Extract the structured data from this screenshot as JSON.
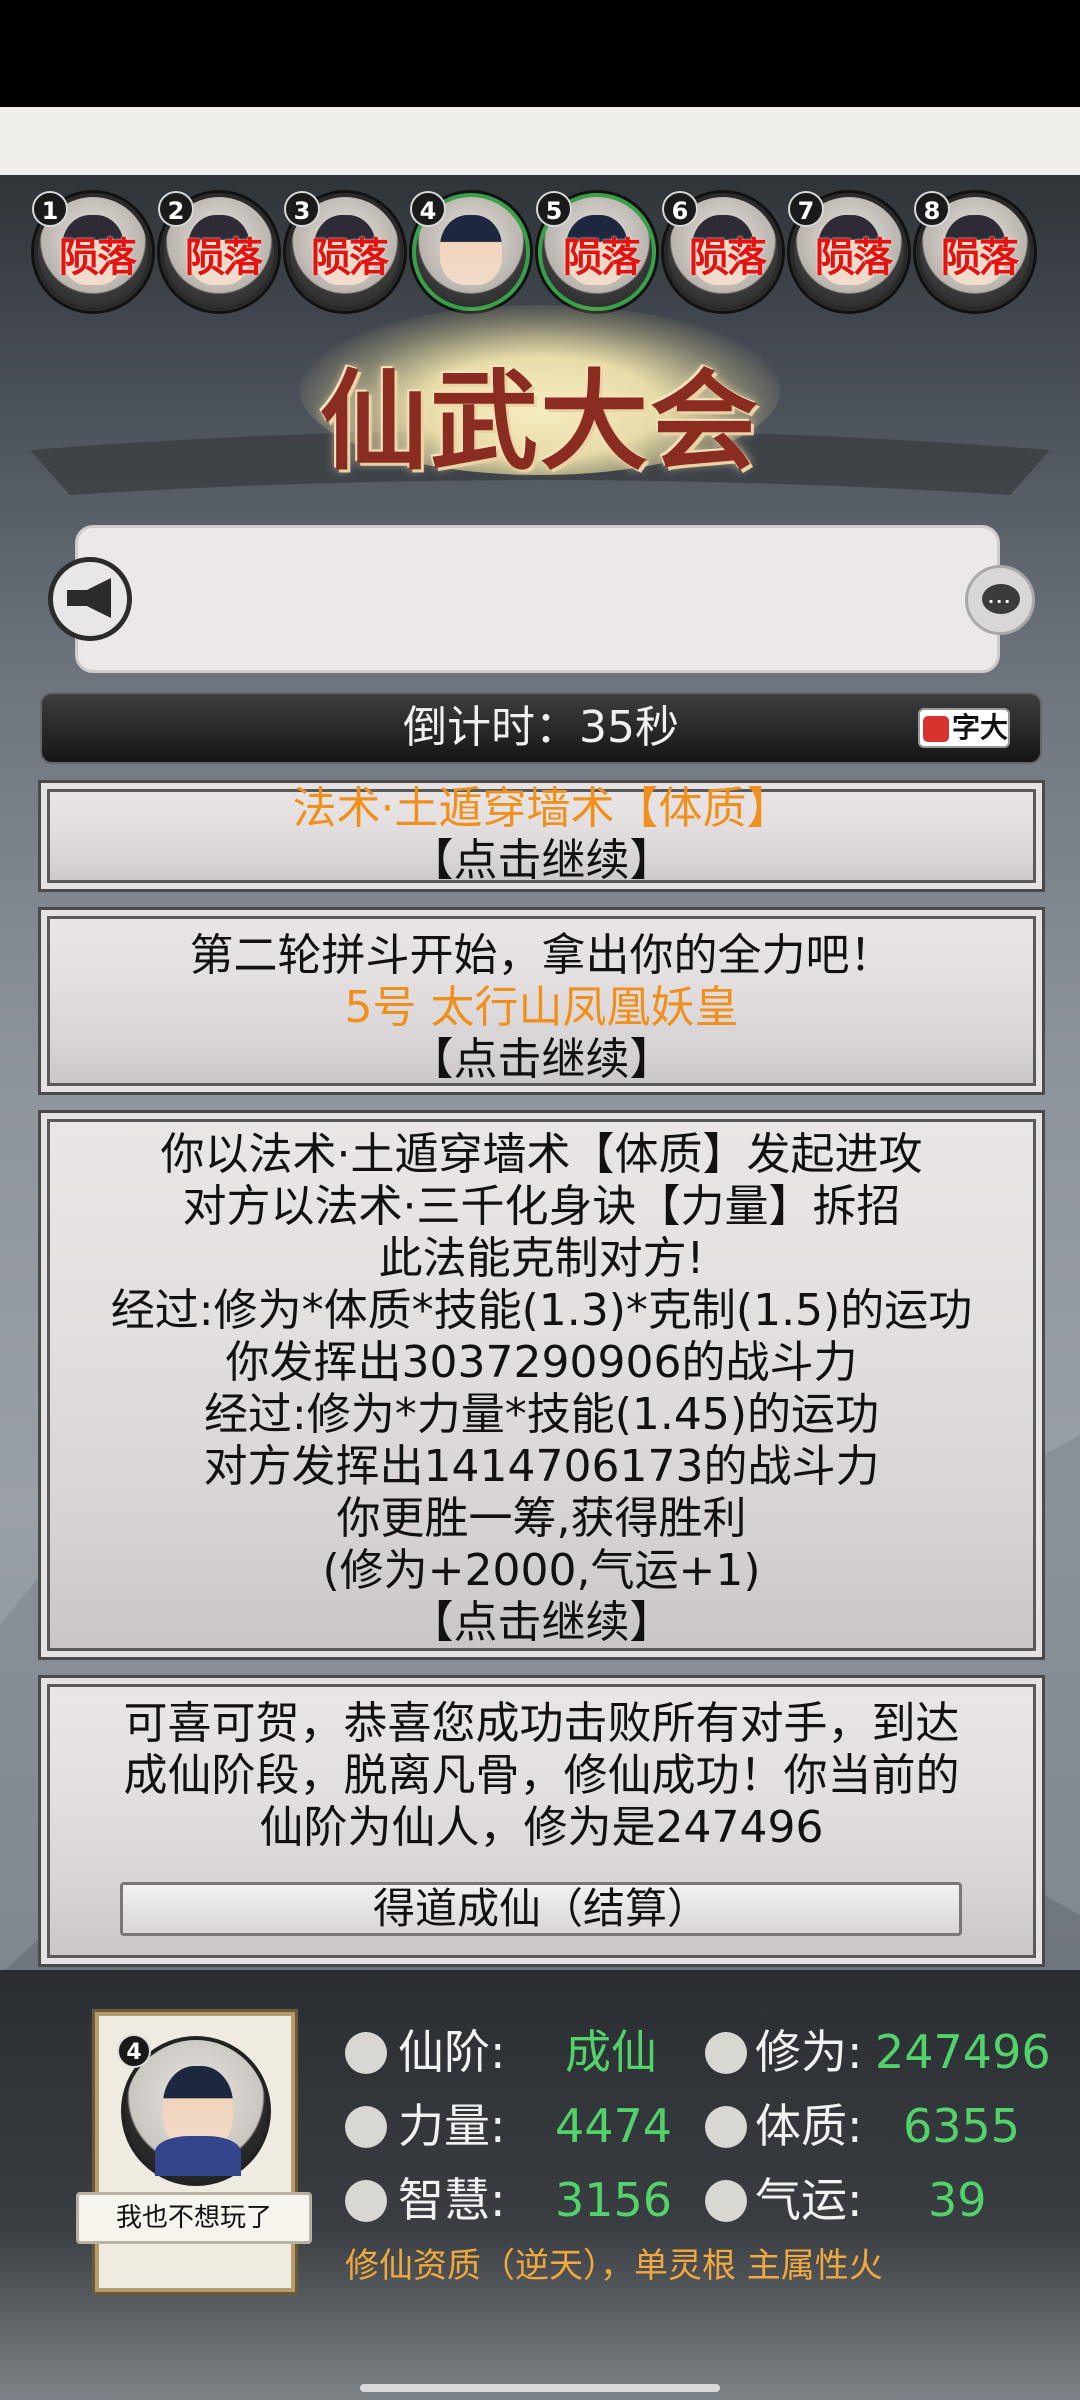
{
  "avatars": [
    {
      "num": "1",
      "status": "陨落"
    },
    {
      "num": "2",
      "status": "陨落"
    },
    {
      "num": "3",
      "status": "陨落"
    },
    {
      "num": "4",
      "status": ""
    },
    {
      "num": "5",
      "status": "陨落"
    },
    {
      "num": "6",
      "status": "陨落"
    },
    {
      "num": "7",
      "status": "陨落"
    },
    {
      "num": "8",
      "status": "陨落"
    }
  ],
  "title": "仙武大会",
  "countdown": "倒计时：35秒",
  "font_toggle": "字大",
  "log": {
    "panel1": {
      "line1": "法术·土遁穿墙术【体质】",
      "continue": "【点击继续】"
    },
    "panel2": {
      "line1": "第二轮拼斗开始，拿出你的全力吧！",
      "line2": "5号 太行山凤凰妖皇",
      "continue": "【点击继续】"
    },
    "panel3": {
      "line1": "你以法术·土遁穿墙术【体质】发起进攻",
      "line2": "对方以法术·三千化身诀【力量】拆招",
      "line3": "此法能克制对方!",
      "line4": "经过:修为*体质*技能(1.3)*克制(1.5)的运功",
      "line5": "你发挥出3037290906的战斗力",
      "line6": "经过:修为*力量*技能(1.45)的运功",
      "line7": "对方发挥出1414706173的战斗力",
      "line8": "你更胜一筹,获得胜利",
      "line9": "(修为+2000,气运+1)",
      "continue": "【点击继续】"
    },
    "panel4": {
      "line1": "可喜可贺，恭喜您成功击败所有对手，到达",
      "line2": "成仙阶段，脱离凡骨，修仙成功！你当前的",
      "line3": "仙阶为仙人，修为是247496",
      "button": "得道成仙（结算）"
    }
  },
  "player": {
    "num": "4",
    "name": "我也不想玩了",
    "stats": {
      "rank_label": "仙阶:",
      "rank_value": "成仙",
      "cultivation_label": "修为:",
      "cultivation_value": "247496",
      "strength_label": "力量:",
      "strength_value": "4474",
      "physique_label": "体质:",
      "physique_value": "6355",
      "wisdom_label": "智慧:",
      "wisdom_value": "3156",
      "luck_label": "气运:",
      "luck_value": "39"
    },
    "aptitude": "修仙资质（逆天），单灵根 主属性火"
  },
  "colors": {
    "value_green": "#52d36a",
    "highlight_orange": "#f0901c",
    "dead_red": "#e3140f",
    "alive_ring": "#38a049"
  }
}
